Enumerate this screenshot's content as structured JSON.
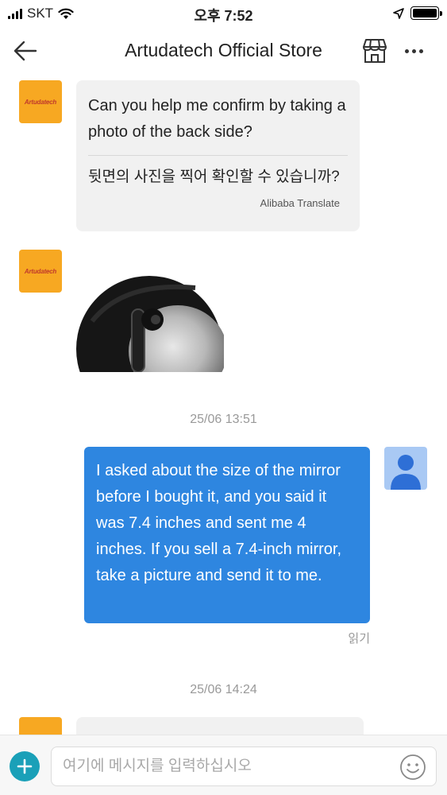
{
  "status_bar": {
    "carrier": "SKT",
    "time": "오후 7:52",
    "icons": [
      "signal-icon",
      "wifi-icon",
      "location-arrow-icon",
      "battery-icon"
    ]
  },
  "nav": {
    "title": "Artudatech Official Store",
    "icons": [
      "back-arrow-icon",
      "store-icon",
      "more-icon"
    ]
  },
  "store_avatar_text": "Artudatech",
  "messages": [
    {
      "sender": "store",
      "text_en": "Can you help me confirm  by taking a photo of the back side?",
      "text_ko": "뒷면의 사진을 찍어 확인할 수 있습니까?",
      "translate_label": "Alibaba Translate"
    },
    {
      "sender": "store",
      "type": "image"
    },
    {
      "type": "timestamp",
      "text": "25/06 13:51"
    },
    {
      "sender": "user",
      "text": "I asked about the size of the mirror before I bought it, and you said it was 7.4 inches and sent me 4 inches. If you sell a 7.4-inch mirror, take a picture and send it to me.",
      "status": "읽기"
    },
    {
      "type": "timestamp",
      "text": "25/06 14:24"
    }
  ],
  "input_bar": {
    "placeholder": "여기에 메시지를 입력하십시오",
    "value": "",
    "icons": [
      "plus-icon",
      "emoji-icon"
    ]
  },
  "colors": {
    "outgoing_bubble": "#2e86e0",
    "incoming_bubble": "#f1f1f1",
    "store_avatar": "#f7a822",
    "add_button": "#1aa0b8"
  }
}
